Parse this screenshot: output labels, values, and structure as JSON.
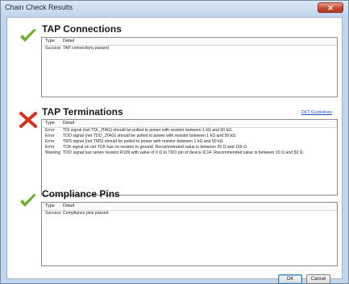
{
  "window": {
    "title": "Chain Check Results",
    "close_glyph": "✕"
  },
  "columns": {
    "type": "Type",
    "detail": "Detail"
  },
  "sections": [
    {
      "title": "TAP Connections",
      "status": "success",
      "rows": [
        {
          "type": "Success",
          "detail": "TAP connections passed"
        }
      ]
    },
    {
      "title": "TAP Terminations",
      "status": "error",
      "link": "DFT Guidelines",
      "rows": [
        {
          "type": "Error",
          "detail": "TDI signal (net TDI_JTAG) should be pulled to power with resistor between 1 kΩ and 50 kΩ."
        },
        {
          "type": "Error",
          "detail": "TDO signal (net TDO_JTAG) should be pulled to power with resistor between 1 kΩ and 50 kΩ."
        },
        {
          "type": "Error",
          "detail": "TMS signal (net TMS) should be pulled to power with resistor between 1 kΩ and 50 kΩ."
        },
        {
          "type": "Error",
          "detail": "TCK signal on net TCK has no resistor to ground. Recommended value is between 25 Ω and 150 Ω."
        },
        {
          "type": "Warning",
          "detail": "TDO signal has series resistor R109 with value of 0 Ω to TDO pin of device IC14. Recommended value is between 10 Ω and 50 Ω."
        }
      ]
    },
    {
      "title": "Compliance Pins",
      "status": "success",
      "rows": [
        {
          "type": "Success",
          "detail": "Compliance pins passed"
        }
      ]
    }
  ],
  "buttons": {
    "ok": "OK",
    "cancel": "Cancel"
  },
  "colors": {
    "success": "#6cae2e",
    "error": "#d8301c",
    "link": "#1f4fd1"
  },
  "icons": {
    "success": "check-icon",
    "error": "x-icon"
  }
}
